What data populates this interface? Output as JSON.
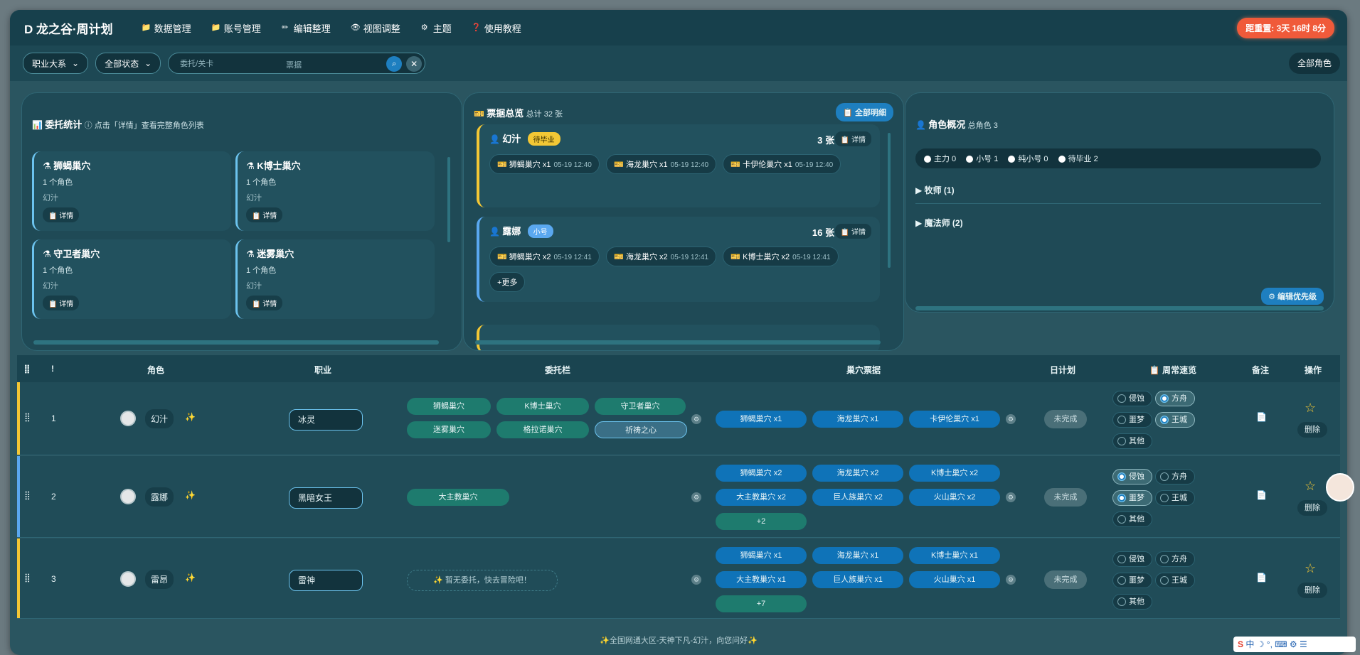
{
  "app": {
    "brand": "D 龙之谷·周计划",
    "countdown": "距重置: 3天 16时 8分"
  },
  "menu": [
    {
      "label": "数据管理",
      "icon": "📁"
    },
    {
      "label": "账号管理",
      "icon": "📁"
    },
    {
      "label": "编辑整理",
      "icon": "✏"
    },
    {
      "label": "视图调整",
      "icon": "👁"
    },
    {
      "label": "主题",
      "icon": "⚙"
    },
    {
      "label": "使用教程",
      "icon": "❓"
    }
  ],
  "filters": {
    "profession": "职业大系",
    "status": "全部状态",
    "search_placeholder": "委托/关卡",
    "search_placeholder2": "票据",
    "all_roles": "全部角色"
  },
  "commission": {
    "title": "委托统计",
    "hint": "ⓘ 点击「详情」查看完整角色列表",
    "cards": [
      {
        "title": "狮蝎巢穴",
        "count": "1 个角色",
        "names": "幻汁",
        "detail": "详情"
      },
      {
        "title": "K博士巢穴",
        "count": "1 个角色",
        "names": "幻汁",
        "detail": "详情"
      },
      {
        "title": "守卫者巢穴",
        "count": "1 个角色",
        "names": "幻汁",
        "detail": "详情"
      },
      {
        "title": "迷雾巢穴",
        "count": "1 个角色",
        "names": "幻汁",
        "detail": "详情"
      }
    ]
  },
  "tickets": {
    "title": "票据总览",
    "total": "总计 32 张",
    "all_detail": "全部明细",
    "cards": [
      {
        "name": "幻汁",
        "badge": "待毕业",
        "count": "3 张",
        "detail": "详情",
        "chips": [
          {
            "label": "狮蝎巢穴 x1",
            "time": "05-19 12:40"
          },
          {
            "label": "海龙巢穴 x1",
            "time": "05-19 12:40"
          },
          {
            "label": "卡伊伦巢穴 x1",
            "time": "05-19 12:40"
          }
        ]
      },
      {
        "name": "露娜",
        "badge": "小号",
        "count": "16 张",
        "detail": "详情",
        "chips": [
          {
            "label": "狮蝎巢穴 x2",
            "time": "05-19 12:41"
          },
          {
            "label": "海龙巢穴 x2",
            "time": "05-19 12:41"
          },
          {
            "label": "K博士巢穴 x2",
            "time": "05-19 12:41"
          }
        ],
        "more": "+更多"
      }
    ]
  },
  "roles": {
    "title": "角色概况",
    "total": "总角色 3",
    "legend": [
      "主力 0",
      "小号 1",
      "纯小号 0",
      "待毕业 2"
    ],
    "groups": [
      "牧师 (1)",
      "魔法师 (2)"
    ],
    "edit_priority": "编辑优先级"
  },
  "table": {
    "headers": {
      "drag": "⣿",
      "idx": "!",
      "role": "角色",
      "job": "职业",
      "commission": "委托栏",
      "tickets": "巢穴票据",
      "daily": "日计划",
      "weekly": "周常速览",
      "note": "备注",
      "ops": "操作"
    },
    "rows": [
      {
        "idx": "1",
        "name": "幻汁",
        "job": "冰灵",
        "commissions": [
          "狮蝎巢穴",
          "K博士巢穴",
          "守卫者巢穴",
          "迷雾巢穴",
          "格拉诺巢穴",
          "祈祷之心"
        ],
        "tickets": [
          "狮蝎巢穴 x1",
          "海龙巢穴 x1",
          "卡伊伦巢穴 x1"
        ],
        "status": "未完成",
        "weekly": [
          "侵蚀",
          "方舟",
          "噩梦",
          "王城",
          "其他"
        ],
        "delete": "删除"
      },
      {
        "idx": "2",
        "name": "露娜",
        "job": "黑暗女王",
        "commissions": [
          "大主教巢穴"
        ],
        "tickets": [
          "狮蝎巢穴 x2",
          "海龙巢穴 x2",
          "K博士巢穴 x2",
          "大主教巢穴 x2",
          "巨人族巢穴 x2",
          "火山巢穴 x2"
        ],
        "more": "+2",
        "status": "未完成",
        "weekly": [
          "侵蚀",
          "方舟",
          "噩梦",
          "王城",
          "其他"
        ],
        "delete": "删除"
      },
      {
        "idx": "3",
        "name": "雷昂",
        "job": "雷神",
        "empty": "✨ 暂无委托，快去冒险吧！",
        "tickets": [
          "狮蝎巢穴 x1",
          "海龙巢穴 x1",
          "K博士巢穴 x1",
          "大主教巢穴 x1",
          "巨人族巢穴 x1",
          "火山巢穴 x1"
        ],
        "more": "+7",
        "status": "未完成",
        "weekly": [
          "侵蚀",
          "方舟",
          "噩梦",
          "王城",
          "其他"
        ],
        "delete": "删除"
      }
    ]
  },
  "footer": "✨全国网通大区-天神下凡-幻汁，向您问好✨",
  "colors": {
    "accent": "#1e7fc0",
    "countdown": "#f05a3a",
    "pending_badge": "#f3c735",
    "alt_badge": "#5aa8f0"
  }
}
